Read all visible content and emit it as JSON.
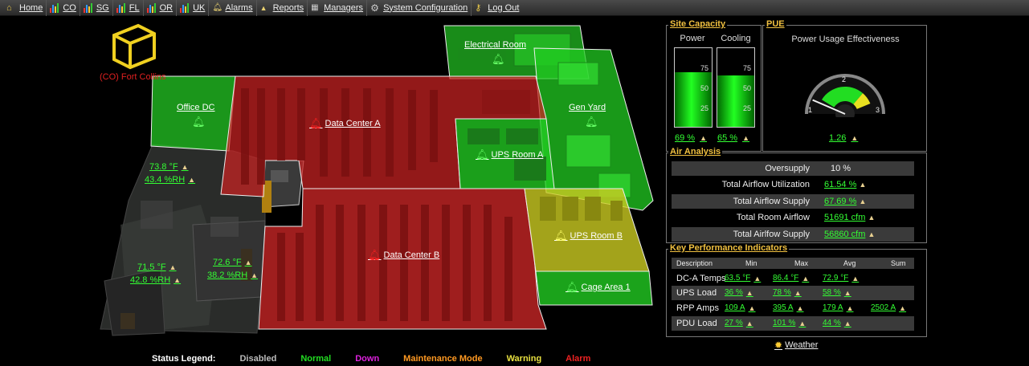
{
  "nav": {
    "home": "Home",
    "co": "CO",
    "sg": "SG",
    "fl": "FL",
    "or": "OR",
    "uk": "UK",
    "alarms": "Alarms",
    "reports": "Reports",
    "managers": "Managers",
    "system_configuration": "System Configuration",
    "log_out": "Log Out"
  },
  "site": {
    "name": "(CO) Fort Collins"
  },
  "rooms": {
    "electrical_room": "Electrical Room",
    "office_dc": "Office DC",
    "data_center_a": "Data Center A",
    "gen_yard": "Gen Yard",
    "ups_room_a": "UPS Room A",
    "data_center_b": "Data Center B",
    "ups_room_b": "UPS Room B",
    "cage_area_1": "Cage Area 1"
  },
  "sensors": {
    "s1_temp": "73.8 °F",
    "s1_rh": "43.4 %RH",
    "s2_temp": "71.5 °F",
    "s2_rh": "42.8 %RH",
    "s3_temp": "72.6 °F",
    "s3_rh": "38.2 %RH"
  },
  "legend": {
    "title": "Status Legend:",
    "disabled": "Disabled",
    "normal": "Normal",
    "down": "Down",
    "maintenance": "Maintenance Mode",
    "warning": "Warning",
    "alarm": "Alarm"
  },
  "site_capacity": {
    "title": "Site Capacity",
    "power_label": "Power",
    "cooling_label": "Cooling",
    "ticks": [
      "75",
      "50",
      "25"
    ],
    "power_value": "69 %",
    "cooling_value": "65 %",
    "power_level": 0.69,
    "cooling_level": 0.65
  },
  "pue": {
    "title": "PUE",
    "subtitle": "Power Usage Effectiveness",
    "scale": [
      "1",
      "2",
      "3"
    ],
    "value": "1.26",
    "numeric": 1.26
  },
  "air_analysis": {
    "title": "Air Analysis",
    "rows": [
      {
        "label": "Oversupply",
        "value": "10 %"
      },
      {
        "label": "Total Airflow Utilization",
        "value": "61.54 %"
      },
      {
        "label": "Total Airflow Supply",
        "value": "67.69 %"
      },
      {
        "label": "Total Room Airflow",
        "value": "51691 cfm"
      },
      {
        "label": "Total Airlfow Supply",
        "value": "56860 cfm"
      }
    ]
  },
  "kpi": {
    "title": "Key Performance Indicators",
    "headers": [
      "Description",
      "Min",
      "Max",
      "Avg",
      "Sum"
    ],
    "rows": [
      {
        "desc": "DC-A Temps",
        "min": "63.5 °F",
        "max": "86.4 °F",
        "avg": "72.9 °F",
        "sum": ""
      },
      {
        "desc": "UPS Load",
        "min": "36 %",
        "max": "78 %",
        "avg": "58 %",
        "sum": ""
      },
      {
        "desc": "RPP Amps",
        "min": "109 A",
        "max": "395 A",
        "avg": "179 A",
        "sum": "2502 A"
      },
      {
        "desc": "PDU Load",
        "min": "27 %",
        "max": "101 %",
        "avg": "44 %",
        "sum": ""
      }
    ]
  },
  "weather": {
    "label": "Weather"
  },
  "colors": {
    "normal": "#22dd22",
    "alarm": "#dd2222",
    "warning": "#e8e040",
    "down": "#dd22dd",
    "maintenance": "#ff9922",
    "disabled": "#bbbbbb",
    "accent": "#f0c040"
  }
}
